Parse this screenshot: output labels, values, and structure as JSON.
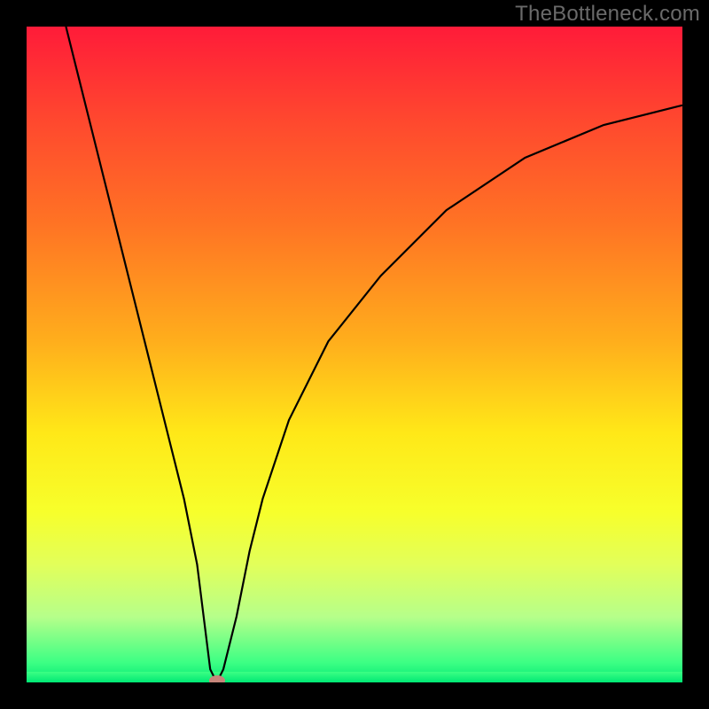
{
  "watermark": "TheBottleneck.com",
  "chart_data": {
    "type": "line",
    "title": "",
    "xlabel": "",
    "ylabel": "",
    "xlim": [
      0,
      100
    ],
    "ylim": [
      0,
      100
    ],
    "background_gradient": {
      "orientation": "vertical",
      "stops": [
        {
          "pos": 0.0,
          "color": "#ff1b39"
        },
        {
          "pos": 0.15,
          "color": "#ff4a2e"
        },
        {
          "pos": 0.3,
          "color": "#ff7324"
        },
        {
          "pos": 0.48,
          "color": "#ffae1c"
        },
        {
          "pos": 0.62,
          "color": "#ffe818"
        },
        {
          "pos": 0.74,
          "color": "#f7ff2b"
        },
        {
          "pos": 0.82,
          "color": "#e2ff5a"
        },
        {
          "pos": 0.9,
          "color": "#b6ff8a"
        },
        {
          "pos": 0.97,
          "color": "#3cff84"
        },
        {
          "pos": 1.0,
          "color": "#00e874"
        }
      ]
    },
    "series": [
      {
        "name": "curve",
        "color": "#000000",
        "type": "line",
        "x": [
          6,
          8,
          10,
          12,
          14,
          16,
          18,
          20,
          22,
          24,
          26,
          27,
          28,
          29,
          30,
          32,
          34,
          36,
          40,
          46,
          54,
          64,
          76,
          88,
          100
        ],
        "y": [
          100,
          92,
          84,
          76,
          68,
          60,
          52,
          44,
          36,
          28,
          18,
          10,
          2,
          0,
          2,
          10,
          20,
          28,
          40,
          52,
          62,
          72,
          80,
          85,
          88
        ]
      }
    ],
    "marker": {
      "name": "minimum-point",
      "x": 29,
      "y": 0,
      "color": "#c6857a"
    }
  }
}
